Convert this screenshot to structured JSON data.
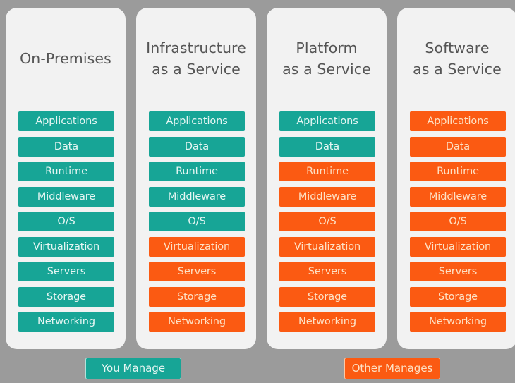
{
  "colors": {
    "background": "#9b9b9b",
    "panel": "#f2f2f2",
    "you_manage": "#17a596",
    "other_manages": "#fb5a12",
    "title_text": "#555555"
  },
  "columns": [
    {
      "title_lines": [
        "On-Premises"
      ],
      "layers": [
        {
          "label": "Applications",
          "managed_by": "you"
        },
        {
          "label": "Data",
          "managed_by": "you"
        },
        {
          "label": "Runtime",
          "managed_by": "you"
        },
        {
          "label": "Middleware",
          "managed_by": "you"
        },
        {
          "label": "O/S",
          "managed_by": "you"
        },
        {
          "label": "Virtualization",
          "managed_by": "you"
        },
        {
          "label": "Servers",
          "managed_by": "you"
        },
        {
          "label": "Storage",
          "managed_by": "you"
        },
        {
          "label": "Networking",
          "managed_by": "you"
        }
      ]
    },
    {
      "title_lines": [
        "Infrastructure",
        "as a Service"
      ],
      "layers": [
        {
          "label": "Applications",
          "managed_by": "you"
        },
        {
          "label": "Data",
          "managed_by": "you"
        },
        {
          "label": "Runtime",
          "managed_by": "you"
        },
        {
          "label": "Middleware",
          "managed_by": "you"
        },
        {
          "label": "O/S",
          "managed_by": "you"
        },
        {
          "label": "Virtualization",
          "managed_by": "other"
        },
        {
          "label": "Servers",
          "managed_by": "other"
        },
        {
          "label": "Storage",
          "managed_by": "other"
        },
        {
          "label": "Networking",
          "managed_by": "other"
        }
      ]
    },
    {
      "title_lines": [
        "Platform",
        "as a Service"
      ],
      "layers": [
        {
          "label": "Applications",
          "managed_by": "you"
        },
        {
          "label": "Data",
          "managed_by": "you"
        },
        {
          "label": "Runtime",
          "managed_by": "other"
        },
        {
          "label": "Middleware",
          "managed_by": "other"
        },
        {
          "label": "O/S",
          "managed_by": "other"
        },
        {
          "label": "Virtualization",
          "managed_by": "other"
        },
        {
          "label": "Servers",
          "managed_by": "other"
        },
        {
          "label": "Storage",
          "managed_by": "other"
        },
        {
          "label": "Networking",
          "managed_by": "other"
        }
      ]
    },
    {
      "title_lines": [
        "Software",
        "as a Service"
      ],
      "layers": [
        {
          "label": "Applications",
          "managed_by": "other"
        },
        {
          "label": "Data",
          "managed_by": "other"
        },
        {
          "label": "Runtime",
          "managed_by": "other"
        },
        {
          "label": "Middleware",
          "managed_by": "other"
        },
        {
          "label": "O/S",
          "managed_by": "other"
        },
        {
          "label": "Virtualization",
          "managed_by": "other"
        },
        {
          "label": "Servers",
          "managed_by": "other"
        },
        {
          "label": "Storage",
          "managed_by": "other"
        },
        {
          "label": "Networking",
          "managed_by": "other"
        }
      ]
    }
  ],
  "legend": {
    "you_manage": "You Manage",
    "other_manages": "Other Manages"
  }
}
